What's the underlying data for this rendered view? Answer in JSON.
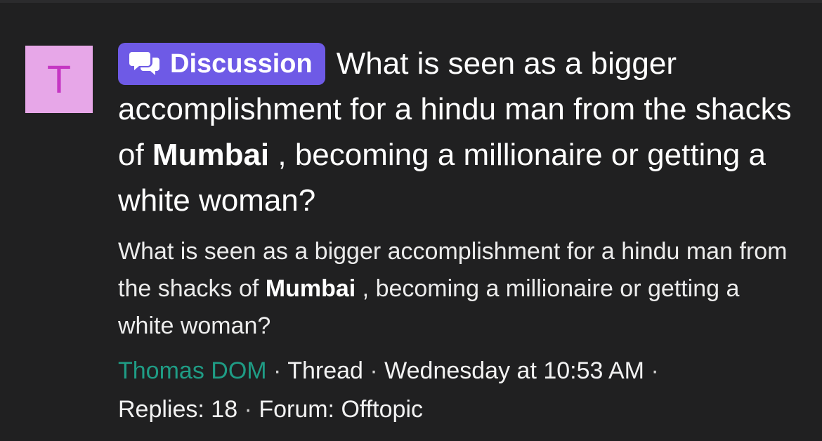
{
  "avatar": {
    "letter": "T",
    "bg_color": "#e7a7e8",
    "letter_color": "#c537c3"
  },
  "badge": {
    "label": "Discussion",
    "icon": "chat-bubbles-icon",
    "color": "#6e5ae6"
  },
  "title": {
    "part1": "What is seen as a bigger accomplishment for a hindu man from the shacks of ",
    "bold": "Mumbai",
    "part2": " , becoming a millionaire or getting a white woman?"
  },
  "snippet": {
    "part1": "What is seen as a bigger accomplishment for a hindu man from the shacks of ",
    "bold": "Mumbai",
    "part2": " , becoming a millionaire or getting a white woman?"
  },
  "meta": {
    "author": "Thomas DOM",
    "author_color": "#1f9c85",
    "separator": " · ",
    "type": "Thread",
    "date": "Wednesday at 10:53 AM",
    "replies": "Replies: 18",
    "forum": "Forum: Offtopic"
  }
}
